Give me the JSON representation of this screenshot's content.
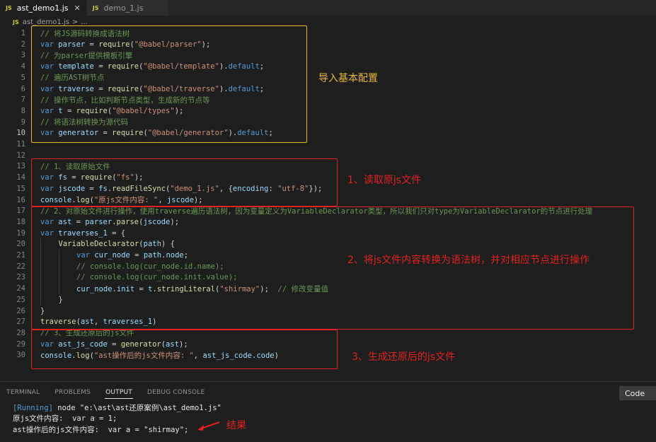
{
  "tabs": [
    {
      "label": "ast_demo1.js",
      "badge": "JS",
      "active": true,
      "close": "✕"
    },
    {
      "label": "demo_1.js",
      "badge": "JS",
      "active": false
    }
  ],
  "breadcrumb": {
    "badge": "JS",
    "file": "ast_demo1.js",
    "sep": ">",
    "rest": "..."
  },
  "lines": [
    {
      "n": "1",
      "indent": 0,
      "tokens": [
        [
          "cm",
          "// 将JS源码转换成语法树"
        ]
      ]
    },
    {
      "n": "2",
      "indent": 0,
      "tokens": [
        [
          "kw",
          "var "
        ],
        [
          "var",
          "parser"
        ],
        [
          "pl",
          " = "
        ],
        [
          "fn",
          "require"
        ],
        [
          "pl",
          "("
        ],
        [
          "str",
          "\"@babel/parser\""
        ],
        [
          "pl",
          ");"
        ]
      ]
    },
    {
      "n": "3",
      "indent": 0,
      "tokens": [
        [
          "cm",
          "// 为parser提供模板引擎"
        ]
      ]
    },
    {
      "n": "4",
      "indent": 0,
      "tokens": [
        [
          "kw",
          "var "
        ],
        [
          "var",
          "template"
        ],
        [
          "pl",
          " = "
        ],
        [
          "fn",
          "require"
        ],
        [
          "pl",
          "("
        ],
        [
          "str",
          "\"@babel/template\""
        ],
        [
          "pl",
          ")."
        ],
        [
          "kw",
          "default"
        ],
        [
          "pl",
          ";"
        ]
      ]
    },
    {
      "n": "5",
      "indent": 0,
      "tokens": [
        [
          "cm",
          "// 遍历AST树节点"
        ]
      ]
    },
    {
      "n": "6",
      "indent": 0,
      "tokens": [
        [
          "kw",
          "var "
        ],
        [
          "var",
          "traverse"
        ],
        [
          "pl",
          " = "
        ],
        [
          "fn",
          "require"
        ],
        [
          "pl",
          "("
        ],
        [
          "str",
          "\"@babel/traverse\""
        ],
        [
          "pl",
          ")."
        ],
        [
          "kw",
          "default"
        ],
        [
          "pl",
          ";"
        ]
      ]
    },
    {
      "n": "7",
      "indent": 0,
      "tokens": [
        [
          "cm",
          "// 操作节点，比如判断节点类型，生成新的节点等"
        ]
      ]
    },
    {
      "n": "8",
      "indent": 0,
      "tokens": [
        [
          "kw",
          "var "
        ],
        [
          "var",
          "t"
        ],
        [
          "pl",
          " = "
        ],
        [
          "fn",
          "require"
        ],
        [
          "pl",
          "("
        ],
        [
          "str",
          "\"@babel/types\""
        ],
        [
          "pl",
          ");"
        ]
      ]
    },
    {
      "n": "9",
      "indent": 0,
      "tokens": [
        [
          "cm",
          "// 将语法树转换为源代码"
        ]
      ]
    },
    {
      "n": "10",
      "indent": 0,
      "cur": true,
      "tokens": [
        [
          "kw",
          "var "
        ],
        [
          "var",
          "generator"
        ],
        [
          "pl",
          " = "
        ],
        [
          "fn",
          "require"
        ],
        [
          "pl",
          "("
        ],
        [
          "str",
          "\"@babel/generator\""
        ],
        [
          "pl",
          ")."
        ],
        [
          "kw",
          "default"
        ],
        [
          "pl",
          ";"
        ]
      ]
    },
    {
      "n": "11",
      "indent": 0,
      "tokens": []
    },
    {
      "n": "12",
      "indent": 0,
      "tokens": []
    },
    {
      "n": "13",
      "indent": 0,
      "tokens": [
        [
          "cm",
          "// 1、读取原始文件"
        ]
      ]
    },
    {
      "n": "14",
      "indent": 0,
      "tokens": [
        [
          "kw",
          "var "
        ],
        [
          "var",
          "fs"
        ],
        [
          "pl",
          " = "
        ],
        [
          "fn",
          "require"
        ],
        [
          "pl",
          "("
        ],
        [
          "str",
          "\"fs\""
        ],
        [
          "pl",
          ");"
        ]
      ]
    },
    {
      "n": "15",
      "indent": 0,
      "tokens": [
        [
          "kw",
          "var "
        ],
        [
          "var",
          "jscode"
        ],
        [
          "pl",
          " = "
        ],
        [
          "var",
          "fs"
        ],
        [
          "pl",
          "."
        ],
        [
          "fn",
          "readFileSync"
        ],
        [
          "pl",
          "("
        ],
        [
          "str",
          "\"demo_1.js\""
        ],
        [
          "pl",
          ", {"
        ],
        [
          "var",
          "encoding"
        ],
        [
          "pl",
          ": "
        ],
        [
          "str",
          "\"utf-8\""
        ],
        [
          "pl",
          "});"
        ]
      ]
    },
    {
      "n": "16",
      "indent": 0,
      "tokens": [
        [
          "var",
          "console"
        ],
        [
          "pl",
          "."
        ],
        [
          "fn",
          "log"
        ],
        [
          "pl",
          "("
        ],
        [
          "str",
          "\"原js文件内容: \""
        ],
        [
          "pl",
          ", "
        ],
        [
          "var",
          "jscode"
        ],
        [
          "pl",
          ");"
        ]
      ]
    },
    {
      "n": "17",
      "indent": 0,
      "tokens": [
        [
          "cm",
          "// 2、对原始文件进行操作，使用traverse遍历语法树，因为变量定义为VariableDeclarator类型，所以我们只对type为VariableDeclarator的节点进行处理"
        ]
      ]
    },
    {
      "n": "18",
      "indent": 0,
      "tokens": [
        [
          "kw",
          "var "
        ],
        [
          "var",
          "ast"
        ],
        [
          "pl",
          " = "
        ],
        [
          "var",
          "parser"
        ],
        [
          "pl",
          "."
        ],
        [
          "fn",
          "parse"
        ],
        [
          "pl",
          "("
        ],
        [
          "var",
          "jscode"
        ],
        [
          "pl",
          ");"
        ]
      ]
    },
    {
      "n": "19",
      "indent": 0,
      "tokens": [
        [
          "kw",
          "var "
        ],
        [
          "var",
          "traverses_1"
        ],
        [
          "pl",
          " = {"
        ]
      ]
    },
    {
      "n": "20",
      "indent": 1,
      "tokens": [
        [
          "fn",
          "VariableDeclarator"
        ],
        [
          "pl",
          "("
        ],
        [
          "var",
          "path"
        ],
        [
          "pl",
          ") {"
        ]
      ]
    },
    {
      "n": "21",
      "indent": 2,
      "tokens": [
        [
          "kw",
          "var "
        ],
        [
          "var",
          "cur_node"
        ],
        [
          "pl",
          " = "
        ],
        [
          "var",
          "path"
        ],
        [
          "pl",
          "."
        ],
        [
          "var",
          "node"
        ],
        [
          "pl",
          ";"
        ]
      ]
    },
    {
      "n": "22",
      "indent": 2,
      "tokens": [
        [
          "cm",
          "// console.log(cur_node.id.name);"
        ]
      ]
    },
    {
      "n": "23",
      "indent": 2,
      "tokens": [
        [
          "cm",
          "// console.log(cur_node.init.value);"
        ]
      ]
    },
    {
      "n": "24",
      "indent": 2,
      "tokens": [
        [
          "var",
          "cur_node"
        ],
        [
          "pl",
          "."
        ],
        [
          "var",
          "init"
        ],
        [
          "pl",
          " = "
        ],
        [
          "var",
          "t"
        ],
        [
          "pl",
          "."
        ],
        [
          "fn",
          "stringLiteral"
        ],
        [
          "pl",
          "("
        ],
        [
          "str",
          "\"shirmay\""
        ],
        [
          "pl",
          ");  "
        ],
        [
          "cm",
          "// 修改变量值"
        ]
      ]
    },
    {
      "n": "25",
      "indent": 1,
      "tokens": [
        [
          "pl",
          "}"
        ]
      ]
    },
    {
      "n": "26",
      "indent": 0,
      "tokens": [
        [
          "pl",
          "}"
        ]
      ]
    },
    {
      "n": "27",
      "indent": 0,
      "tokens": [
        [
          "fn",
          "traverse"
        ],
        [
          "pl",
          "("
        ],
        [
          "var",
          "ast"
        ],
        [
          "pl",
          ", "
        ],
        [
          "var",
          "traverses_1"
        ],
        [
          "pl",
          ")"
        ]
      ]
    },
    {
      "n": "28",
      "indent": 0,
      "tokens": [
        [
          "cm",
          "// 3、生成还原后的js文件"
        ]
      ]
    },
    {
      "n": "29",
      "indent": 0,
      "tokens": [
        [
          "kw",
          "var "
        ],
        [
          "var",
          "ast_js_code"
        ],
        [
          "pl",
          " = "
        ],
        [
          "fn",
          "generator"
        ],
        [
          "pl",
          "("
        ],
        [
          "var",
          "ast"
        ],
        [
          "pl",
          ");"
        ]
      ]
    },
    {
      "n": "30",
      "indent": 0,
      "tokens": [
        [
          "var",
          "console"
        ],
        [
          "pl",
          "."
        ],
        [
          "fn",
          "log"
        ],
        [
          "pl",
          "("
        ],
        [
          "str",
          "\"ast操作后的js文件内容: \""
        ],
        [
          "pl",
          ", "
        ],
        [
          "var",
          "ast_js_code"
        ],
        [
          "pl",
          "."
        ],
        [
          "var",
          "code"
        ],
        [
          "pl",
          ")"
        ]
      ]
    }
  ],
  "annotations": {
    "import_config": "导入基本配置",
    "step1": "1、读取原js文件",
    "step2": "2、将js文件内容转换为语法树，并对相应节点进行操作",
    "step3": "3、生成还原后的js文件",
    "result": "结果"
  },
  "colors": {
    "annotation_yellow": "#e8b83a",
    "annotation_red": "#e02222"
  },
  "panel": {
    "tabs": [
      {
        "label": "TERMINAL",
        "active": false
      },
      {
        "label": "PROBLEMS",
        "active": false
      },
      {
        "label": "OUTPUT",
        "active": true
      },
      {
        "label": "DEBUG CONSOLE",
        "active": false
      }
    ],
    "channel": "Code",
    "output": {
      "running_tag": "[Running]",
      "running_cmd": " node \"e:\\ast\\ast还原案例\\ast_demo1.js\"",
      "line2": "原js文件内容:  var a = 1;",
      "line3": "ast操作后的js文件内容:  var a = \"shirmay\";"
    }
  }
}
